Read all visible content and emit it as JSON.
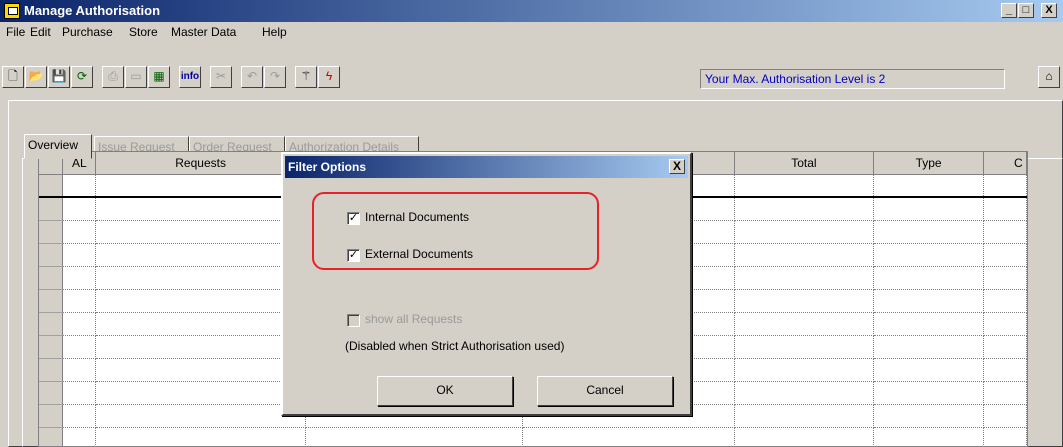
{
  "window": {
    "title": "Manage Authorisation",
    "min": "_",
    "max": "□",
    "close": "X"
  },
  "menu": [
    "File",
    "Edit",
    "Purchase",
    "Store",
    "Master Data",
    "Help"
  ],
  "toolbar": {
    "info_label": "info",
    "status_text": "Your Max. Authorisation Level is 2"
  },
  "tabs": [
    {
      "label": "Overview",
      "active": true
    },
    {
      "label": "Issue Request",
      "active": false
    },
    {
      "label": "Order Request",
      "active": false
    },
    {
      "label": "Authorization Details",
      "active": false
    }
  ],
  "grid": {
    "columns": [
      "AL",
      "Requests",
      "",
      "",
      "Total",
      "Type",
      "C"
    ]
  },
  "dialog": {
    "title": "Filter Options",
    "close": "X",
    "internal_documents": {
      "label": "Internal Documents",
      "checked": true
    },
    "external_documents": {
      "label": "External Documents",
      "checked": true
    },
    "show_all": {
      "label": "show all Requests",
      "checked": false,
      "disabled": true
    },
    "note": "(Disabled when Strict Authorisation used)",
    "ok_label": "OK",
    "cancel_label": "Cancel"
  }
}
